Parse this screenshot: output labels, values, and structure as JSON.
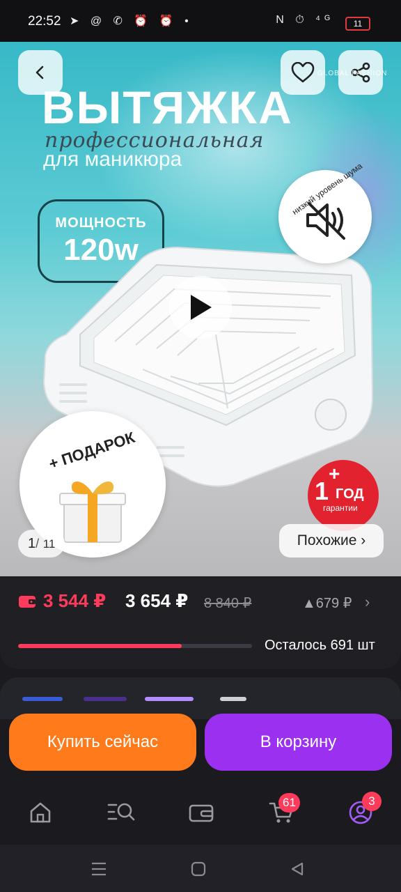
{
  "status_bar": {
    "time": "22:52",
    "left_icons": "➤ @ ✆ ⏰ ⏰ •",
    "right_icons": "N ⏱ ⁴ᴳ",
    "battery": "11"
  },
  "hero": {
    "title": "ВЫТЯЖКА",
    "subtitle_script": "профессиональная",
    "subtitle": "для маникюра",
    "power_label": "МОЩНОСТЬ",
    "power_value": "120w",
    "noise_badge": "низкий уровень шума",
    "gift_badge": "+ ПОДАРОК",
    "warranty_plus": "+",
    "warranty_number": "1",
    "warranty_year": "ГОД",
    "warranty_sub": "гарантии",
    "brand_mark": "GLOBAL FASHION",
    "image_counter_current": "1",
    "image_counter_sep": "/",
    "image_counter_total": "11",
    "similar_button": "Похожие ›"
  },
  "price": {
    "wallet_price": "3 544 ₽",
    "price": "3 654 ₽",
    "old_price": "8 840 ₽",
    "diff": "▲679 ₽",
    "stock_text": "Осталось 691 шт",
    "stock_fraction": 0.7
  },
  "actions": {
    "buy_now": "Купить сейчас",
    "add_to_cart": "В корзину"
  },
  "tabbar": {
    "cart_badge": "61",
    "profile_badge": "3"
  },
  "colors": {
    "accent_red": "#ff3b5c",
    "buy_orange": "#ff7a1a",
    "cart_purple": "#9b30f0"
  }
}
